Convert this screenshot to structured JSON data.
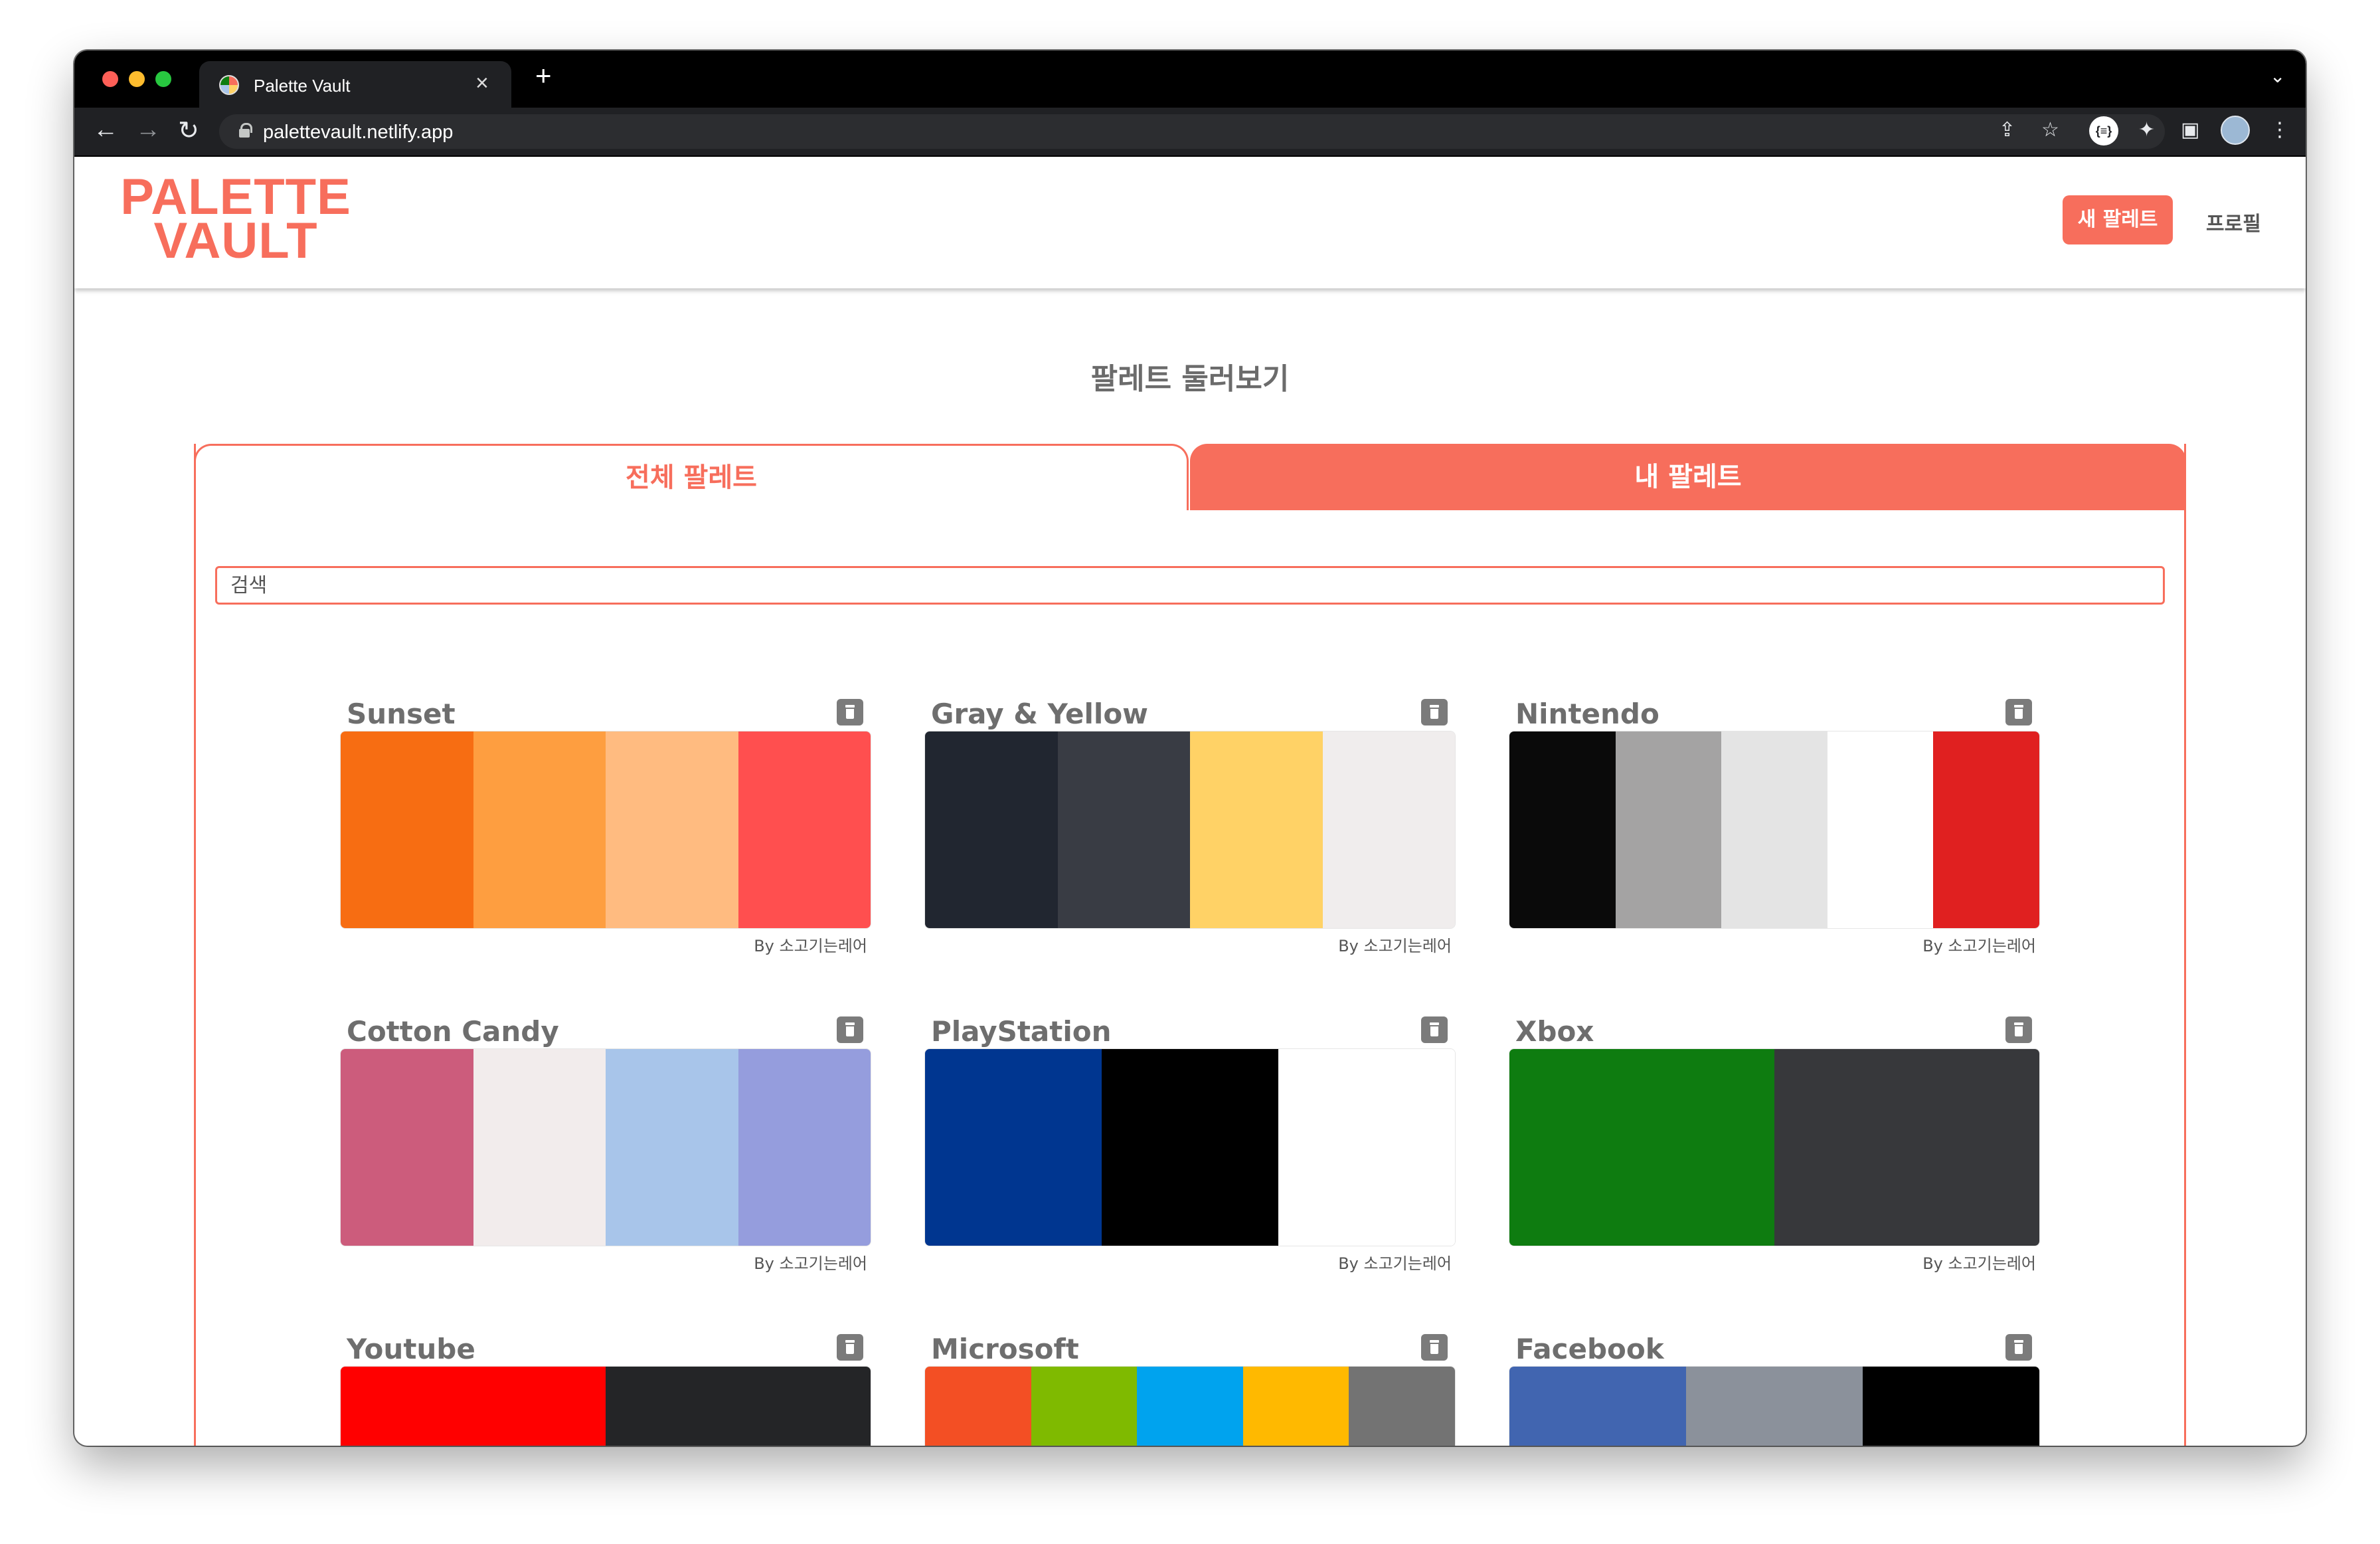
{
  "browser": {
    "tab_title": "Palette Vault",
    "tab_close": "×",
    "new_tab": "+",
    "tab_dropdown": "⌄",
    "url": "palettevault.netlify.app",
    "ext_label": "{≡}"
  },
  "header": {
    "logo_line1": "PALETTE",
    "logo_line2": "VAULT",
    "new_palette_label": "새 팔레트",
    "profile_label": "프로필",
    "brand_color": "#f76e5c"
  },
  "main": {
    "title": "팔레트 둘러보기",
    "tabs": [
      {
        "label": "전체 팔레트",
        "active": true
      },
      {
        "label": "내 팔레트",
        "active": false
      }
    ],
    "search": {
      "placeholder": "검색",
      "value": ""
    },
    "palettes": [
      {
        "name": "Sunset",
        "author": "By 소고기는레어",
        "colors": [
          "#f76d12",
          "#fe9e40",
          "#ffbb80",
          "#ff4f4f"
        ]
      },
      {
        "name": "Gray & Yellow",
        "author": "By 소고기는레어",
        "colors": [
          "#212630",
          "#393c44",
          "#ffd266",
          "#f0eded"
        ]
      },
      {
        "name": "Nintendo",
        "author": "By 소고기는레어",
        "colors": [
          "#0a0a0a",
          "#a4a3a3",
          "#e4e4e4",
          "#ffffff",
          "#e02020"
        ]
      },
      {
        "name": "Cotton Candy",
        "author": "By 소고기는레어",
        "colors": [
          "#cc5c7c",
          "#f2ecec",
          "#a8c5ea",
          "#959ddd"
        ]
      },
      {
        "name": "PlayStation",
        "author": "By 소고기는레어",
        "colors": [
          "#003690",
          "#000000",
          "#ffffff"
        ]
      },
      {
        "name": "Xbox",
        "author": "By 소고기는레어",
        "colors": [
          "#0e7c10",
          "#37383b"
        ]
      },
      {
        "name": "Youtube",
        "author": "",
        "colors": [
          "#ff0000",
          "#242527"
        ]
      },
      {
        "name": "Microsoft",
        "author": "",
        "colors": [
          "#f34f24",
          "#7fba00",
          "#00a3ee",
          "#ffb900",
          "#737373"
        ]
      },
      {
        "name": "Facebook",
        "author": "",
        "colors": [
          "#4165b0",
          "#8b919b",
          "#000000"
        ]
      }
    ]
  }
}
